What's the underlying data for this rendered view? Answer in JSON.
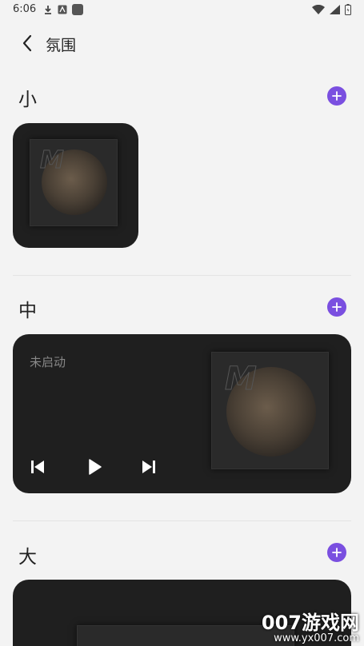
{
  "status_bar": {
    "time": "6:06"
  },
  "header": {
    "title": "氛围"
  },
  "sections": {
    "small": {
      "title": "小"
    },
    "medium": {
      "title": "中",
      "status_text": "未启动"
    },
    "large": {
      "title": "大"
    }
  },
  "album": {
    "logo_text": "M"
  },
  "watermark": {
    "main": "007游戏网",
    "sub": "www.yx007.com"
  },
  "colors": {
    "accent": "#7a4fe0",
    "widget_bg": "#1f1f1f",
    "page_bg": "#f3f3f3"
  }
}
